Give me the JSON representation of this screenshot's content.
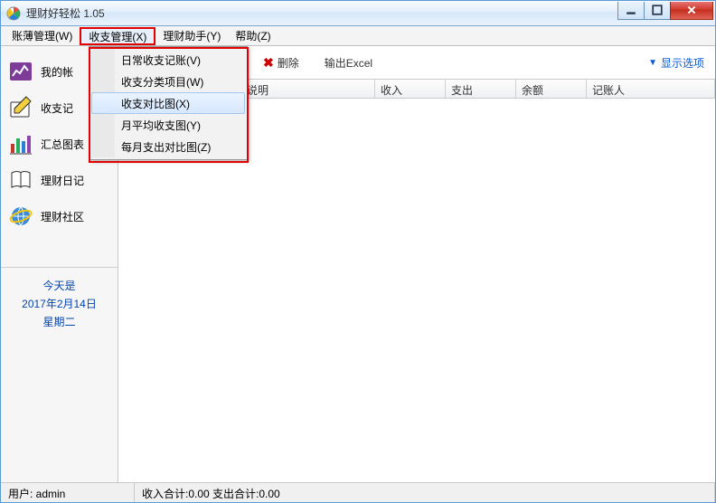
{
  "window": {
    "title": "理财好轻松 1.05"
  },
  "menubar": [
    {
      "label": "账薄管理(W)"
    },
    {
      "label": "收支管理(X)",
      "open": true
    },
    {
      "label": "理财助手(Y)"
    },
    {
      "label": "帮助(Z)"
    }
  ],
  "dropdown": {
    "items": [
      {
        "label": "日常收支记账(V)"
      },
      {
        "label": "收支分类项目(W)"
      },
      {
        "label": "收支对比图(X)",
        "highlight": true
      },
      {
        "label": "月平均收支图(Y)"
      },
      {
        "label": "每月支出对比图(Z)"
      }
    ]
  },
  "sidebar": {
    "items": [
      {
        "label": "我的帐",
        "icon": "chart"
      },
      {
        "label": "收支记",
        "icon": "pencil"
      },
      {
        "label": "汇总图表",
        "icon": "bars"
      },
      {
        "label": "理财日记",
        "icon": "book"
      },
      {
        "label": "理财社区",
        "icon": "ie"
      }
    ],
    "date": {
      "today_label": "今天是",
      "date_label": "2017年2月14日",
      "weekday_label": "星期二"
    }
  },
  "toolbar": {
    "delete_label": "删除",
    "export_label": "输出Excel",
    "show_options_label": "显示选项"
  },
  "table": {
    "columns": [
      {
        "label": "",
        "width": 20
      },
      {
        "label": "",
        "width": 116
      },
      {
        "label": "说明",
        "width": 148
      },
      {
        "label": "收入",
        "width": 78
      },
      {
        "label": "支出",
        "width": 78
      },
      {
        "label": "余额",
        "width": 78
      },
      {
        "label": "记账人",
        "width": 120
      }
    ],
    "rows": []
  },
  "statusbar": {
    "user_label": "用户: admin",
    "summary_label": "收入合计:0.00 支出合计:0.00"
  }
}
